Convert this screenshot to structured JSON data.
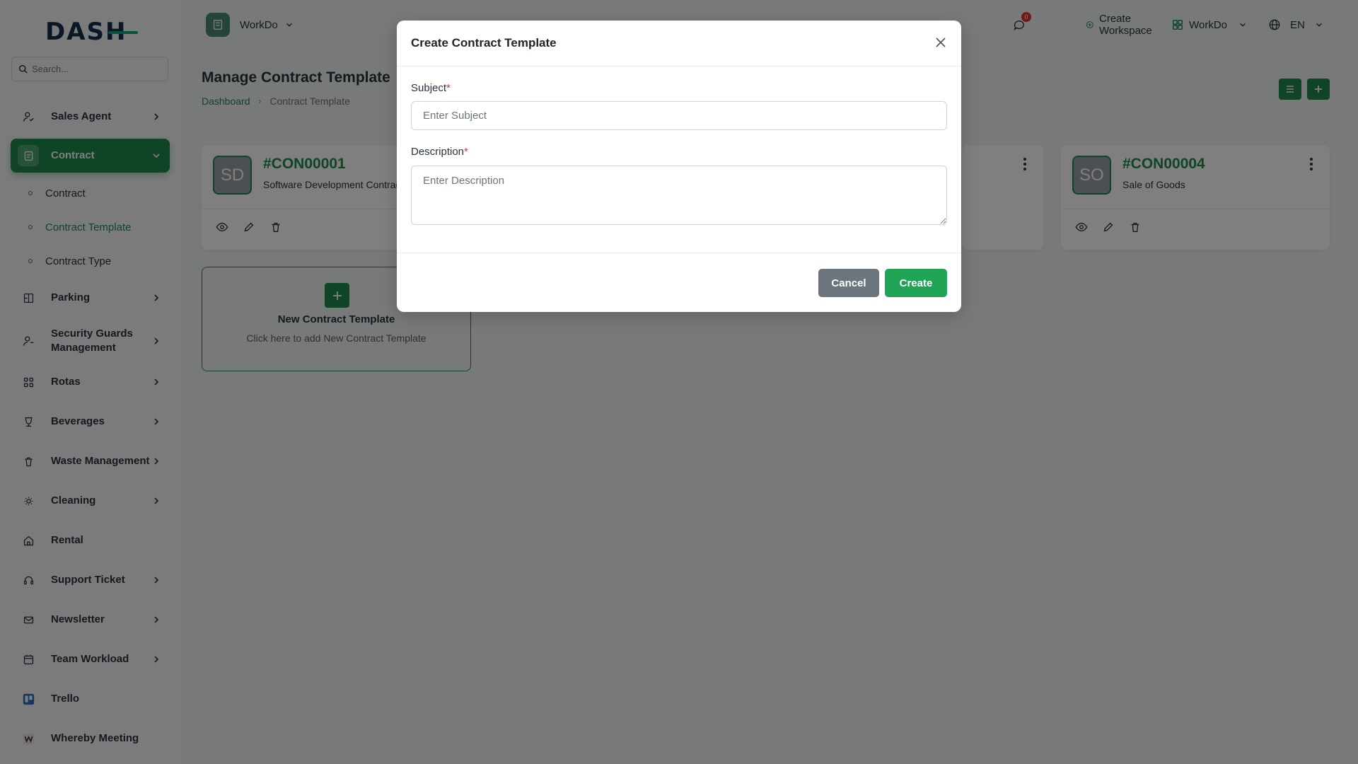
{
  "brand": {
    "logo_text": "DASH"
  },
  "search": {
    "placeholder": "Search..."
  },
  "sidebar": {
    "items": [
      {
        "label": "Sales Agent"
      },
      {
        "label": "Contract"
      },
      {
        "label": "Parking"
      },
      {
        "label": "Security Guards Management"
      },
      {
        "label": "Rotas"
      },
      {
        "label": "Beverages"
      },
      {
        "label": "Waste Management"
      },
      {
        "label": "Cleaning"
      },
      {
        "label": "Rental"
      },
      {
        "label": "Support Ticket"
      },
      {
        "label": "Newsletter"
      },
      {
        "label": "Team Workload"
      },
      {
        "label": "Trello"
      },
      {
        "label": "Whereby Meeting"
      }
    ],
    "contract_sub": [
      {
        "label": "Contract"
      },
      {
        "label": "Contract Template"
      },
      {
        "label": "Contract Type"
      }
    ]
  },
  "topbar": {
    "workspace": "WorkDo",
    "notification_count": "0",
    "create_workspace": "Create Workspace",
    "workspace_menu": "WorkDo",
    "language": "EN"
  },
  "page": {
    "title": "Manage Contract Template",
    "breadcrumb": {
      "home": "Dashboard",
      "current": "Contract Template"
    }
  },
  "cards": [
    {
      "initials": "SD",
      "id": "#CON00001",
      "subtitle": "Software Development Contract"
    },
    {
      "initials": "SO",
      "id": "#CON00004",
      "subtitle": "Sale of Goods"
    }
  ],
  "new_card": {
    "title": "New Contract Template",
    "description": "Click here to add New Contract Template"
  },
  "modal": {
    "title": "Create Contract Template",
    "subject_label": "Subject",
    "subject_placeholder": "Enter Subject",
    "subject_value": "",
    "description_label": "Description",
    "description_placeholder": "Enter Description",
    "description_value": "",
    "required_mark": "*",
    "cancel_label": "Cancel",
    "create_label": "Create"
  },
  "colors": {
    "primary": "#1f8a4c",
    "create_button": "#1fa456",
    "cancel_button": "#6c757d",
    "required": "#e03131"
  }
}
